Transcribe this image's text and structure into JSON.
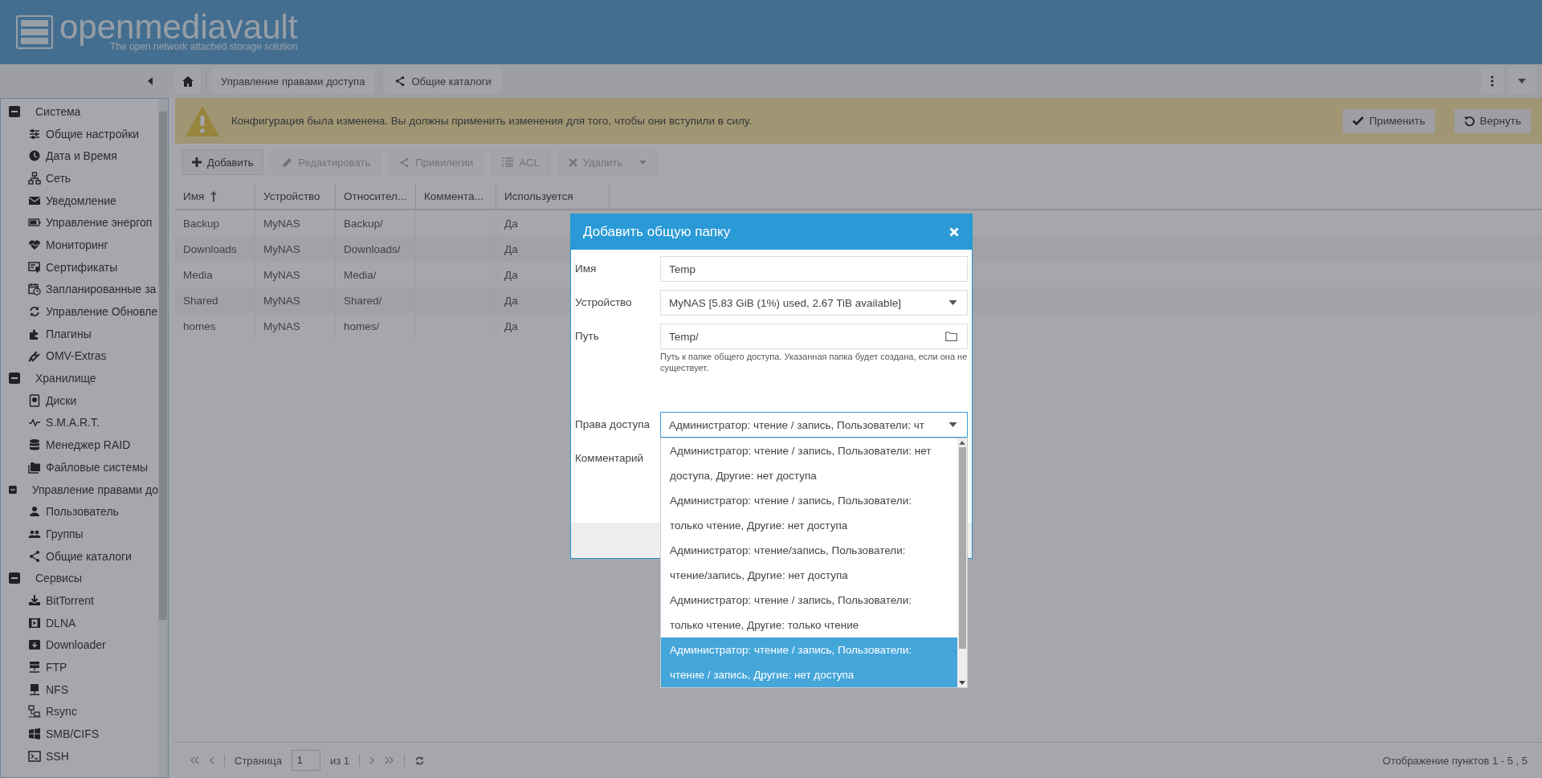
{
  "header": {
    "logo_text": "openmediavault",
    "tagline": "The open network attached storage solution"
  },
  "breadcrumb": [
    {
      "label": "Управление правами доступа"
    },
    {
      "label": "Общие каталоги"
    }
  ],
  "sidebar": {
    "groups": [
      {
        "label": "Система",
        "expanded": true,
        "children": [
          {
            "label": "Общие настройки"
          },
          {
            "label": "Дата и Время"
          },
          {
            "label": "Сеть"
          },
          {
            "label": "Уведомление"
          },
          {
            "label": "Управление энергоп"
          },
          {
            "label": "Мониторинг"
          },
          {
            "label": "Сертификаты"
          },
          {
            "label": "Запланированные за"
          },
          {
            "label": "Управление Обновле"
          },
          {
            "label": "Плагины"
          },
          {
            "label": "OMV-Extras"
          }
        ]
      },
      {
        "label": "Хранилище",
        "expanded": true,
        "children": [
          {
            "label": "Диски"
          },
          {
            "label": "S.M.A.R.T."
          },
          {
            "label": "Менеджер RAID"
          },
          {
            "label": "Файловые системы"
          }
        ]
      },
      {
        "label": "Управление правами до",
        "expanded": true,
        "children": [
          {
            "label": "Пользователь"
          },
          {
            "label": "Группы"
          },
          {
            "label": "Общие каталоги"
          }
        ]
      },
      {
        "label": "Сервисы",
        "expanded": true,
        "children": [
          {
            "label": "BitTorrent"
          },
          {
            "label": "DLNA"
          },
          {
            "label": "Downloader"
          },
          {
            "label": "FTP"
          },
          {
            "label": "NFS"
          },
          {
            "label": "Rsync"
          },
          {
            "label": "SMB/CIFS"
          },
          {
            "label": "SSH"
          }
        ]
      }
    ]
  },
  "notice": {
    "message": "Конфигурация была изменена. Вы должны применить изменения для того, чтобы они вступили в силу.",
    "buttons": [
      "Применить",
      "Вернуть"
    ]
  },
  "toolbar": [
    {
      "label": "Добавить",
      "disabled": false
    },
    {
      "label": "Редактировать",
      "disabled": true
    },
    {
      "label": "Привилегии",
      "disabled": true
    },
    {
      "label": "ACL",
      "disabled": true
    },
    {
      "label": "Удалить",
      "disabled": true
    }
  ],
  "table": {
    "columns": [
      {
        "label": "Имя",
        "sorted": true
      },
      {
        "label": "Устройство"
      },
      {
        "label": "Относител..."
      },
      {
        "label": "Коммента..."
      },
      {
        "label": "Используется"
      }
    ],
    "rows": [
      {
        "name": "Backup",
        "device": "MyNAS",
        "path": "Backup/",
        "used": "Да"
      },
      {
        "name": "Downloads",
        "device": "MyNAS",
        "path": "Downloads/",
        "used": "Да"
      },
      {
        "name": "Media",
        "device": "MyNAS",
        "path": "Media/",
        "used": "Да"
      },
      {
        "name": "Shared",
        "device": "MyNAS",
        "path": "Shared/",
        "used": "Да"
      },
      {
        "name": "homes",
        "device": "MyNAS",
        "path": "homes/",
        "used": "Да"
      }
    ]
  },
  "pagination": {
    "page_label": "Страница",
    "page": "1",
    "of": "из 1",
    "summary": "Отображение пунктов 1 - 5 , 5"
  },
  "dialog": {
    "title": "Добавить общую папку",
    "fields": [
      {
        "kind": "text",
        "label": "Имя",
        "value": "Temp"
      },
      {
        "kind": "select",
        "label": "Устройство",
        "value": "MyNAS [5.83 GiB (1%) used, 2.67 TiB available]",
        "open": false
      },
      {
        "kind": "folder",
        "label": "Путь",
        "value": "Temp/",
        "hint": "Путь к папке общего доступа. Указанная папка будет создана, если она не существует."
      },
      {
        "kind": "select",
        "label": "Права доступа",
        "value": "Администратор: чтение / запись, Пользователи: чт",
        "open": true
      },
      {
        "kind": "textarea",
        "label": "Комментарий"
      }
    ],
    "dropdown": [
      {
        "label": "Администратор: чтение / запись, Пользователи: нет доступа, Другие: нет доступа",
        "selected": false
      },
      {
        "label": "Администратор: чтение / запись, Пользователи: только чтение, Другие: нет доступа",
        "selected": false
      },
      {
        "label": "Администратор: чтение/запись, Пользователи: чтение/запись, Другие: нет доступа",
        "selected": false
      },
      {
        "label": "Администратор: чтение / запись, Пользователи: только чтение, Другие: только чтение",
        "selected": false
      },
      {
        "label": "Администратор: чтение / запись, Пользователи: чтение / запись, Другие: нет доступа",
        "selected": true
      }
    ]
  }
}
